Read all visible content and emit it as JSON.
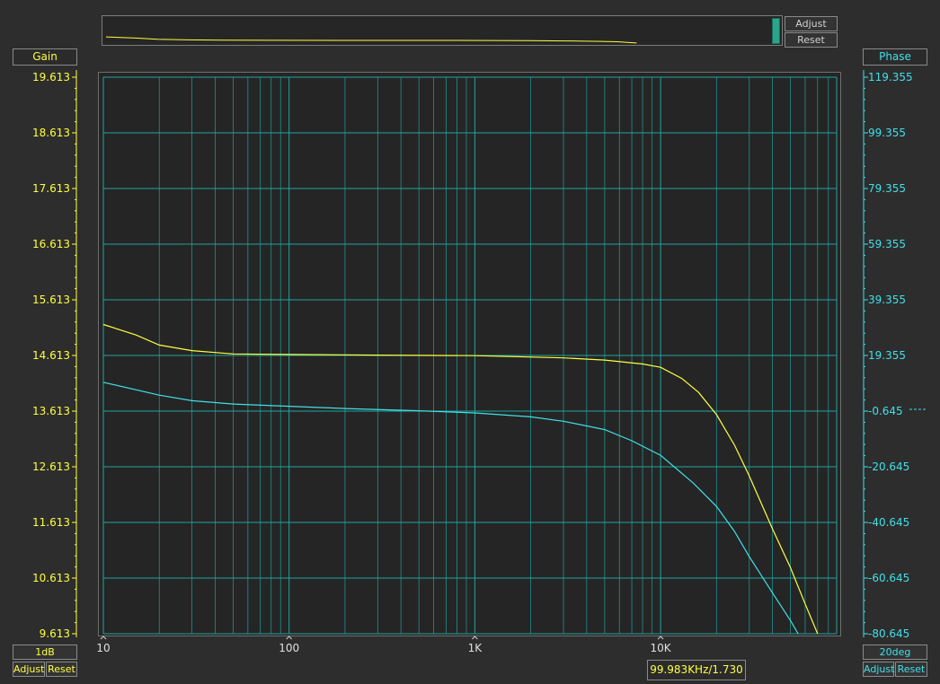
{
  "overview": {
    "adjust_label": "Adjust",
    "reset_label": "Reset"
  },
  "gain_panel": {
    "title": "Gain",
    "scale_label": "1dB",
    "adjust_label": "Adjust",
    "reset_label": "Reset"
  },
  "phase_panel": {
    "title": "Phase",
    "scale_label": "20deg",
    "adjust_label": "Adjust",
    "reset_label": "Reset"
  },
  "cursor_readout": "99.983KHz/1.730",
  "colors": {
    "gain": "#ffff40",
    "phase": "#40e0e8",
    "grid": "#1fa5a0",
    "background": "#252525"
  },
  "chart_data": {
    "type": "line",
    "x_scale": "log",
    "xlim": [
      10,
      80000
    ],
    "x_ticks": [
      {
        "value": 10,
        "label": "10"
      },
      {
        "value": 100,
        "label": "100"
      },
      {
        "value": 1000,
        "label": "1K"
      },
      {
        "value": 10000,
        "label": "10K"
      }
    ],
    "y_left": {
      "ylim": [
        9.613,
        19.613
      ],
      "tick_labels": [
        "19.613",
        "18.613",
        "17.613",
        "16.613",
        "15.613",
        "14.613",
        "13.613",
        "12.613",
        "11.613",
        "10.613",
        "9.613"
      ]
    },
    "y_right": {
      "ylim": [
        -80.645,
        119.355
      ],
      "tick_labels": [
        "119.355",
        "99.355",
        "79.355",
        "59.355",
        "39.355",
        "19.355",
        "-0.645",
        "-20.645",
        "-40.645",
        "-60.645",
        "-80.645"
      ]
    },
    "grid": true,
    "series": [
      {
        "axis": "left",
        "color": "#ffff40",
        "points": [
          [
            10,
            15.17
          ],
          [
            15,
            14.98
          ],
          [
            20,
            14.8
          ],
          [
            30,
            14.7
          ],
          [
            50,
            14.64
          ],
          [
            100,
            14.63
          ],
          [
            300,
            14.62
          ],
          [
            1000,
            14.61
          ],
          [
            3000,
            14.57
          ],
          [
            5000,
            14.53
          ],
          [
            8000,
            14.46
          ],
          [
            10000,
            14.4
          ],
          [
            13000,
            14.2
          ],
          [
            16000,
            13.95
          ],
          [
            20000,
            13.55
          ],
          [
            25000,
            13.0
          ],
          [
            30000,
            12.45
          ],
          [
            40000,
            11.5
          ],
          [
            50000,
            10.8
          ],
          [
            60000,
            10.15
          ],
          [
            70000,
            9.613
          ]
        ]
      },
      {
        "axis": "left",
        "color": "#40e0e8",
        "points": [
          [
            10,
            14.13
          ],
          [
            20,
            13.9
          ],
          [
            30,
            13.8
          ],
          [
            50,
            13.74
          ],
          [
            100,
            13.7
          ],
          [
            200,
            13.66
          ],
          [
            500,
            13.62
          ],
          [
            1000,
            13.58
          ],
          [
            2000,
            13.51
          ],
          [
            3000,
            13.43
          ],
          [
            5000,
            13.28
          ],
          [
            7000,
            13.08
          ],
          [
            10000,
            12.82
          ],
          [
            15000,
            12.32
          ],
          [
            20000,
            11.9
          ],
          [
            25000,
            11.45
          ],
          [
            30000,
            11.0
          ],
          [
            40000,
            10.35
          ],
          [
            50000,
            9.85
          ],
          [
            55000,
            9.613
          ]
        ]
      }
    ]
  }
}
